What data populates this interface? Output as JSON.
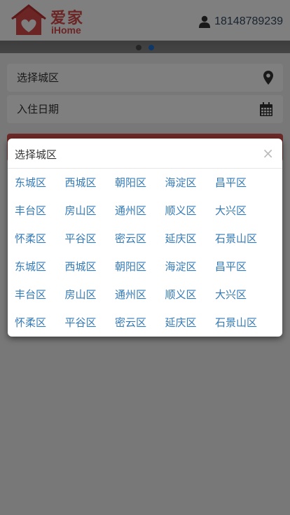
{
  "header": {
    "logo_cn": "爱家",
    "logo_en": "iHome",
    "user_phone": "18148789239"
  },
  "carousel": {
    "dots": 2,
    "active_index": 1
  },
  "search": {
    "area_placeholder": "选择城区",
    "date_placeholder": "入住日期"
  },
  "modal": {
    "title": "选择城区",
    "close_label": "×",
    "rows": [
      [
        "东城区",
        "西城区",
        "朝阳区",
        "海淀区",
        "昌平区"
      ],
      [
        "丰台区",
        "房山区",
        "通州区",
        "顺义区",
        "大兴区"
      ],
      [
        "怀柔区",
        "平谷区",
        "密云区",
        "延庆区",
        "石景山区"
      ],
      [
        "东城区",
        "西城区",
        "朝阳区",
        "海淀区",
        "昌平区"
      ],
      [
        "丰台区",
        "房山区",
        "通州区",
        "顺义区",
        "大兴区"
      ],
      [
        "怀柔区",
        "平谷区",
        "密云区",
        "延庆区",
        "石景山区"
      ]
    ]
  },
  "colors": {
    "brand_red": "#d94a4a",
    "link_blue": "#337ab7",
    "active_dot": "#1f6fd1"
  },
  "icons": {
    "user": "user-icon",
    "location": "map-marker-icon",
    "calendar": "calendar-icon"
  }
}
